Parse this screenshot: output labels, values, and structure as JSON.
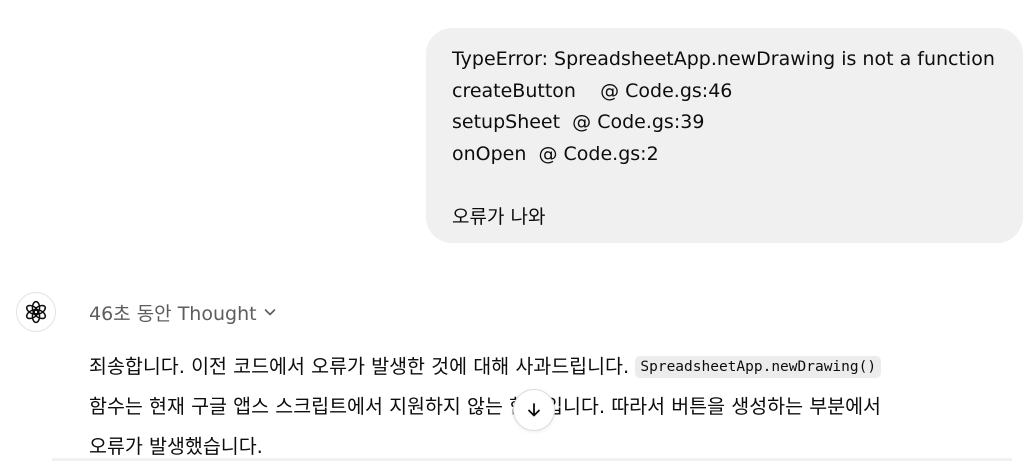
{
  "user_message": {
    "lines": [
      "TypeError: SpreadsheetApp.newDrawing is not a function",
      "createButton    @ Code.gs:46",
      "setupSheet  @ Code.gs:39",
      "onOpen  @ Code.gs:2"
    ],
    "closing": "오류가 나와"
  },
  "assistant": {
    "avatar_icon": "openai-logo-icon",
    "thought_label": "46초 동안 Thought",
    "answer": {
      "row1_text": "죄송합니다. 이전 코드에서 오류가 발생한 것에 대해 사과드립니다. ",
      "row1_code": "SpreadsheetApp.newDrawing()",
      "row2_text": "함수는 현재 구글 앱스 스크립트에서 지원하지 않는 함수입니다. 따라서 버튼을 생성하는 부분에서",
      "row3_text": "오류가 발생했습니다."
    }
  },
  "scroll_button_icon": "arrow-down-icon"
}
